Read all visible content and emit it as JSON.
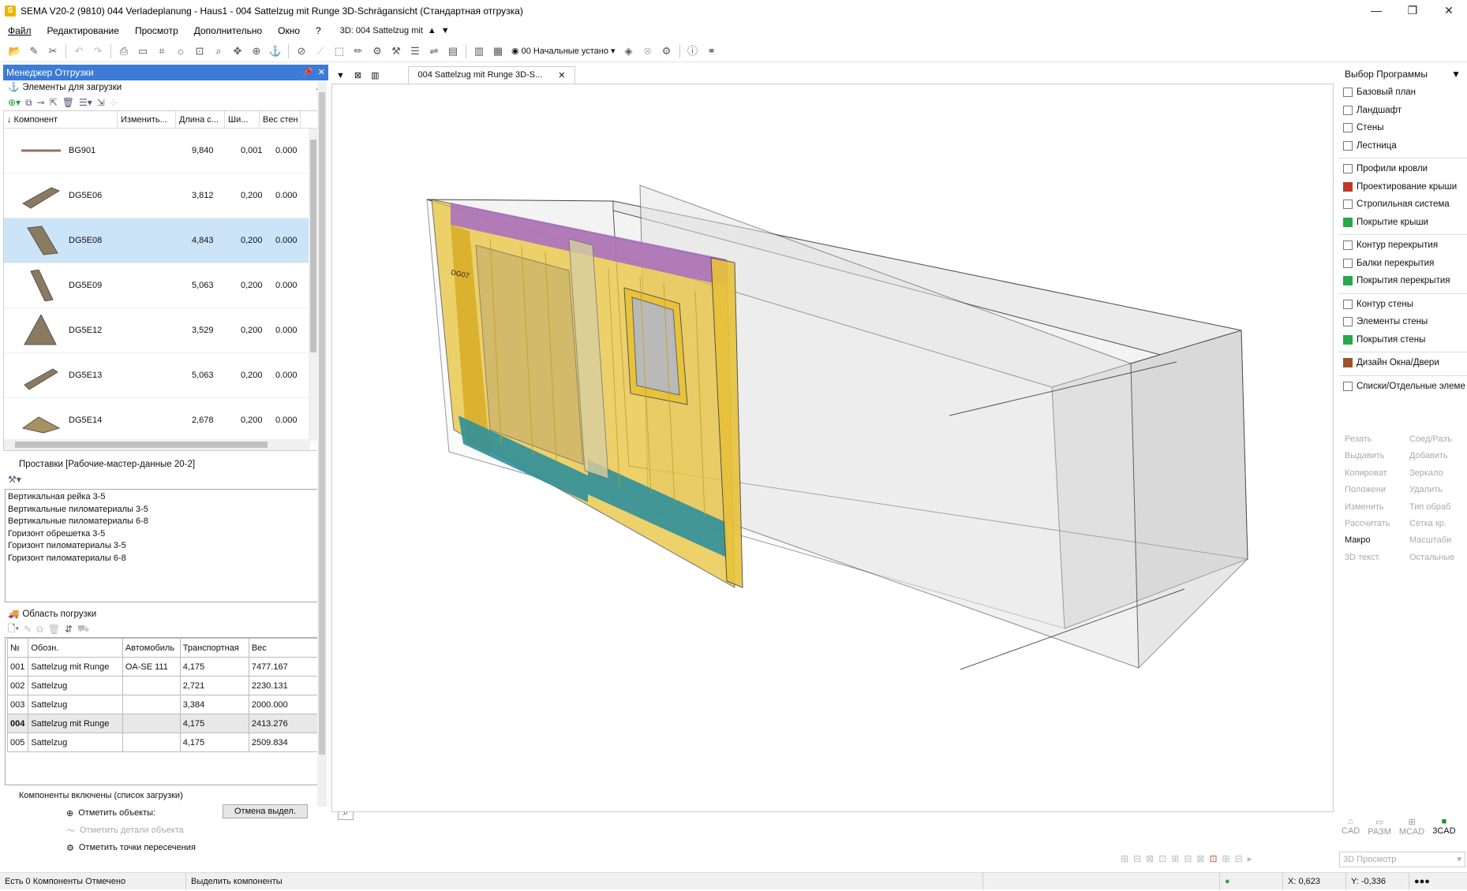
{
  "window": {
    "title": "SEMA V20-2 (9810) 044 Verladeplanung - Haus1 - 004 Sattelzug mit Runge 3D-Schrägansicht (Стандартная отгрузка)",
    "app_letter": "S",
    "minimize": "—",
    "maximize": "❐",
    "close": "✕"
  },
  "menu": {
    "items": [
      "Файл",
      "Редактирование",
      "Просмотр",
      "Дополнительно",
      "Окно",
      "?"
    ],
    "view_combo": "3D: 004 Sattelzug mit"
  },
  "toolbar": {
    "preset_combo": "00 Начальные устано"
  },
  "load_manager": {
    "title": "Менеджер Отгрузки",
    "elements_title": "Элементы для загрузки",
    "columns": [
      "↓ Компонент",
      "Изменить...",
      "Длина с...",
      "Ши...",
      "Вес стен"
    ],
    "rows": [
      {
        "name": "BG901",
        "length": "9,840",
        "width": "0,001",
        "weight": "0.000"
      },
      {
        "name": "DG5E06",
        "length": "3,812",
        "width": "0,200",
        "weight": "0.000"
      },
      {
        "name": "DG5E08",
        "length": "4,843",
        "width": "0,200",
        "weight": "0.000"
      },
      {
        "name": "DG5E09",
        "length": "5,063",
        "width": "0,200",
        "weight": "0.000"
      },
      {
        "name": "DG5E12",
        "length": "3,529",
        "width": "0,200",
        "weight": "0.000"
      },
      {
        "name": "DG5E13",
        "length": "5,063",
        "width": "0,200",
        "weight": "0.000"
      },
      {
        "name": "DG5E14",
        "length": "2,678",
        "width": "0,200",
        "weight": "0.000"
      }
    ],
    "spacers_title": "Проставки [Рабочие-мастер-данные 20-2]",
    "spacers": [
      "Вертикальная рейка 3-5",
      "Вертикальные пиломатериалы 3-5",
      "Вертикальные пиломатериалы 6-8",
      "Горизонт обрешетка 3-5",
      "Горизонт пиломатериалы 3-5",
      "Горизонт пиломатериалы 6-8"
    ],
    "load_area_title": "Область погрузки",
    "load_columns": [
      "№",
      "Обозн.",
      "Автомобиль",
      "Транспортная",
      "Вес"
    ],
    "load_rows": [
      {
        "n": "001",
        "name": "Sattelzug mit Runge",
        "vehicle": "OA-SE 111",
        "transport": "4,175",
        "weight": "7477.167"
      },
      {
        "n": "002",
        "name": "Sattelzug",
        "vehicle": "",
        "transport": "2,721",
        "weight": "2230.131"
      },
      {
        "n": "003",
        "name": "Sattelzug",
        "vehicle": "",
        "transport": "3,384",
        "weight": "2000.000"
      },
      {
        "n": "004",
        "name": "Sattelzug mit Runge",
        "vehicle": "",
        "transport": "4,175",
        "weight": "2413.276"
      },
      {
        "n": "005",
        "name": "Sattelzug",
        "vehicle": "",
        "transport": "4,175",
        "weight": "2509.834"
      }
    ],
    "included_title": "Компоненты включены (список загрузки)",
    "mark_objects": "Отметить объекты:",
    "mark_details": "Отметить детали объекта",
    "mark_intersections": "Отметить точки пересечения",
    "cancel_selection": "Отмена выдел."
  },
  "viewport": {
    "tab_label": "004 Sattelzug mit Runge 3D-S...",
    "element_label": "DG07"
  },
  "program_panel": {
    "title": "Выбор Программы",
    "items": [
      "Базовый план",
      "Ландшафт",
      "Стены",
      "Лестница",
      "Профили кровли",
      "Проектирование крыши",
      "Стропильная система",
      "Покрытие крыши",
      "Контур перекрытия",
      "Балки перекрытия",
      "Покрытия перекрытия",
      "Контур стены",
      "Элементы стены",
      "Покрытия стены",
      "Дизайн Окна/Двери",
      "Списки/Отдельные элеме"
    ],
    "tools": [
      "Резать",
      "Соед/Разъ",
      "Выдавить",
      "Добавить",
      "Копироват",
      "Зеркало",
      "Положени",
      "Удалить",
      "Изменить",
      "Тип обраб",
      "Рассчитать",
      "Сетка кр.",
      "Макро",
      "Масштаби",
      "3D текст.",
      "Остальные"
    ],
    "modes": [
      "CAD",
      "РАЗМ",
      "MCAD",
      "3CAD"
    ],
    "view_combo": "3D Просмотр"
  },
  "status": {
    "left": "Есть 0 Компоненты Отмечено",
    "hint": "Выделить компоненты",
    "x": "X: 0,623",
    "y": "Y: -0,336"
  },
  "colors": {
    "panel_header": "#3c7bd6",
    "selected_row": "#cce4f7",
    "wall_yellow": "#e8c23a",
    "wall_purple": "#a66cc4",
    "wall_teal": "#2f8f9a"
  }
}
